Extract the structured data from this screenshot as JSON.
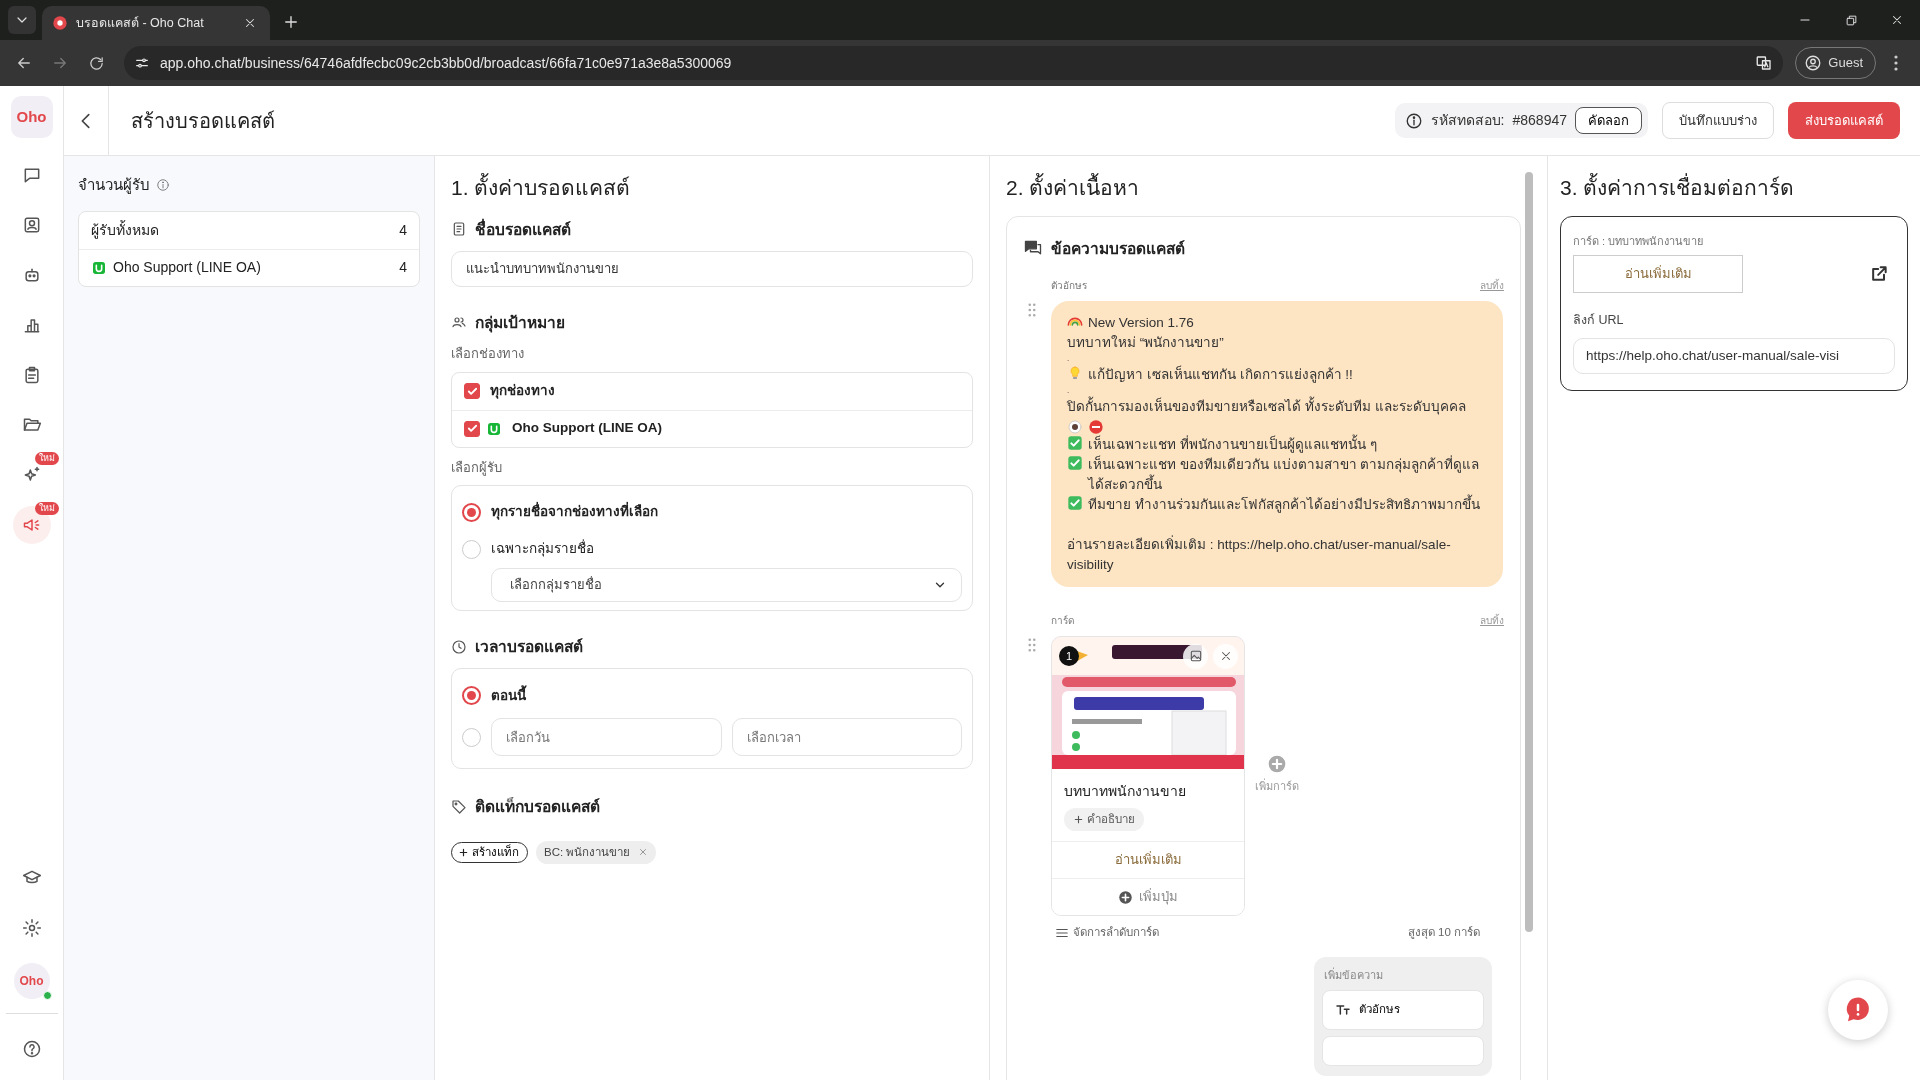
{
  "browser": {
    "tab_title": "บรอดแคสต์ - Oho Chat",
    "url": "app.oho.chat/business/64746afdfecbc09c2cb3bb0d/broadcast/66fa71c0e971a3e8a5300069",
    "profile": "Guest"
  },
  "sidebar": {
    "logo": "Oho",
    "items": [
      {
        "selected": false
      },
      {
        "selected": false
      },
      {
        "selected": false
      },
      {
        "selected": false
      },
      {
        "selected": false
      },
      {
        "selected": false
      },
      {
        "selected": false,
        "badge": "ใหม่"
      },
      {
        "selected": true,
        "badge": "ใหม่"
      }
    ],
    "avatar": "Oho",
    "online": true
  },
  "header": {
    "title": "สร้างบรอดแคสต์",
    "test_code_label": "รหัสทดสอบ:",
    "test_code": "#868947",
    "copy_button": "คัดลอก",
    "draft_button": "บันทึกแบบร่าง",
    "send_button": "ส่งบรอดแคสต์"
  },
  "recipients": {
    "title": "จำนวนผู้รับ",
    "rows": [
      {
        "kind": "total",
        "label": "ผู้รับทั้งหมด",
        "count": "4"
      },
      {
        "kind": "line",
        "label": "Oho Support (LINE OA)",
        "count": "4"
      }
    ]
  },
  "settings": {
    "title": "1. ตั้งค่าบรอดแคสต์",
    "name_heading": "ชื่อบรอดแคสต์",
    "name_value": "แนะนำบทบาทพนักงานขาย",
    "target_heading": "กลุ่มเป้าหมาย",
    "channel_label": "เลือกช่องทาง",
    "channels": [
      {
        "kind": "all",
        "label": "ทุกช่องทาง",
        "checked": true
      },
      {
        "kind": "line",
        "label": "Oho Support (LINE OA)",
        "checked": true
      }
    ],
    "recipient_label": "เลือกผู้รับ",
    "recipient_options": [
      {
        "label": "ทุกรายชื่อจากช่องทางที่เลือก",
        "selected": true
      },
      {
        "label": "เฉพาะกลุ่มรายชื่อ",
        "selected": false
      }
    ],
    "group_select": {
      "placeholder": "เลือกกลุ่มรายชื่อ"
    },
    "time_heading": "เวลาบรอดแคสต์",
    "time_options": [
      {
        "kind": "now",
        "label": "ตอนนี้",
        "selected": true
      },
      {
        "kind": "schedule",
        "selected": false
      }
    ],
    "date_field": {
      "placeholder": "เลือกวัน"
    },
    "time_field": {
      "placeholder": "เลือกเวลา"
    },
    "tag_heading": "ติดแท็กบรอดแคสต์",
    "create_tag": "สร้างแท็ก",
    "tags": [
      "BC: พนักงานขาย"
    ]
  },
  "content": {
    "title": "2. ตั้งค่าเนื้อหา",
    "card_title": "ข้อความบรอดแคสต์",
    "text_block": {
      "label": "ตัวอักษร",
      "delete": "ลบทิ้ง",
      "lines": [
        {
          "kind": "rainbow",
          "text": "New Version 1.76"
        },
        {
          "kind": "plain",
          "text": "บทบาทใหม่ “พนักงานขาย”"
        },
        {
          "kind": "small",
          "text": "."
        },
        {
          "kind": "bulb",
          "text": "แก้ปัญหา เซลเห็นแชทกัน เกิดการแย่งลูกค้า !!"
        },
        {
          "kind": "small",
          "text": "."
        },
        {
          "kind": "plain",
          "text": "ปิดกั้นการมองเห็นของทีมขายหรือเซลได้ ทั้งระดับทีม และระดับบุคคล"
        },
        {
          "kind": "eye-stop"
        },
        {
          "kind": "check",
          "text": "เห็นเฉพาะแชท ที่พนักงานขายเป็นผู้ดูแลแชทนั้น ๆ"
        },
        {
          "kind": "check",
          "text": "เห็นเฉพาะแชท ของทีมเดียวกัน แบ่งตามสาขา ตามกลุ่มลูกค้าที่ดูแลได้สะดวกขึ้น"
        },
        {
          "kind": "check",
          "text": "ทีมขาย ทำงานร่วมกันและโฟกัสลูกค้าได้อย่างมีประสิทธิภาพมากขึ้น"
        },
        {
          "kind": "plain",
          "gap_before": true,
          "text": "อ่านรายละเอียดเพิ่มเติม : https://help.oho.chat/user-manual/sale-visibility"
        }
      ]
    },
    "card_block": {
      "label": "การ์ด",
      "delete": "ลบทิ้ง",
      "cards": [
        {
          "number": "1",
          "title": "บทบาทพนักงานขาย",
          "description_button": "คำอธิบาย",
          "action_button": "อ่านเพิ่มเติม",
          "add_button": "เพิ่มปุ่ม"
        }
      ],
      "add_card": "เพิ่มการ์ด",
      "reorder": "จัดการลำดับการ์ด",
      "limit": "สูงสุด 10 การ์ด"
    },
    "add_message": {
      "title": "เพิ่มข้อความ",
      "options": [
        {
          "kind": "text",
          "label": "ตัวอักษร"
        },
        {
          "kind": "cut"
        }
      ]
    }
  },
  "link_settings": {
    "title": "3. ตั้งค่าการเชื่อมต่อการ์ด",
    "card_label": "การ์ด : บทบาทพนักงานขาย",
    "button_preview": "อ่านเพิ่มเติม",
    "url_label": "ลิงก์ URL",
    "url_value": "https://help.oho.chat/user-manual/sale-visi"
  }
}
